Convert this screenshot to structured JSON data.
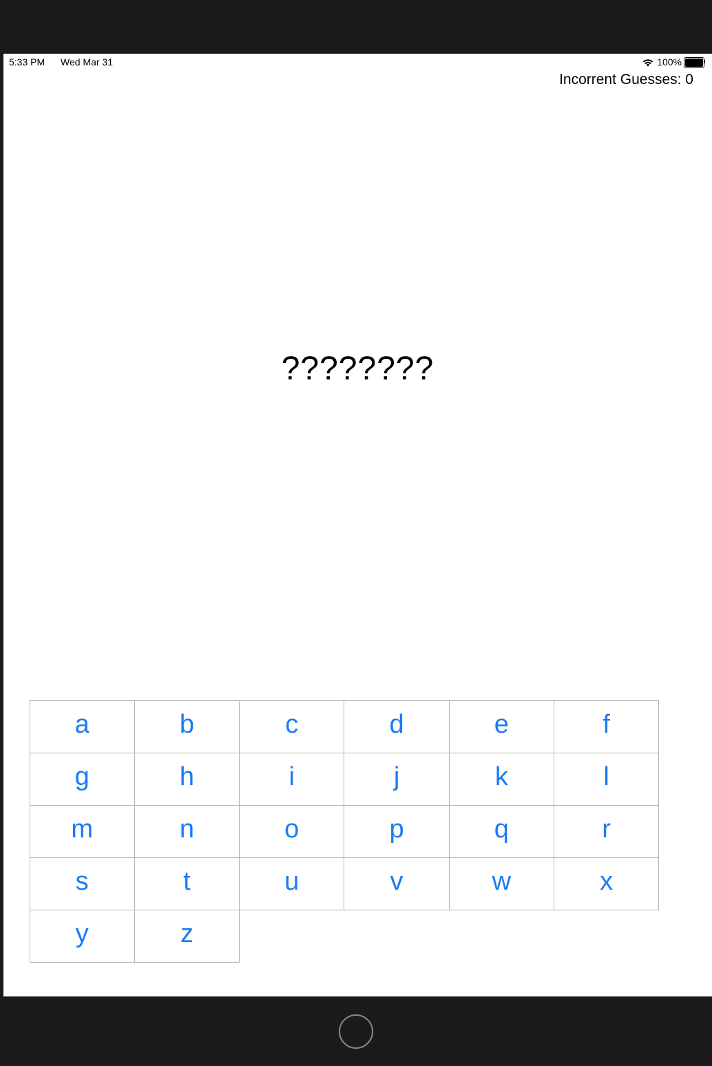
{
  "status_bar": {
    "time": "5:33 PM",
    "date": "Wed Mar 31",
    "battery_percent": "100%",
    "icons": [
      "wifi-icon",
      "battery-icon"
    ]
  },
  "game": {
    "incorrect_label": "Incorrent Guesses: 0",
    "word_display": "????????"
  },
  "keyboard": {
    "keys": [
      "a",
      "b",
      "c",
      "d",
      "e",
      "f",
      "g",
      "h",
      "i",
      "j",
      "k",
      "l",
      "m",
      "n",
      "o",
      "p",
      "q",
      "r",
      "s",
      "t",
      "u",
      "v",
      "w",
      "x",
      "y",
      "z"
    ]
  },
  "colors": {
    "key_text": "#1a7cf5",
    "key_border": "#b3b3b3",
    "bezel": "#1b1b1b"
  }
}
